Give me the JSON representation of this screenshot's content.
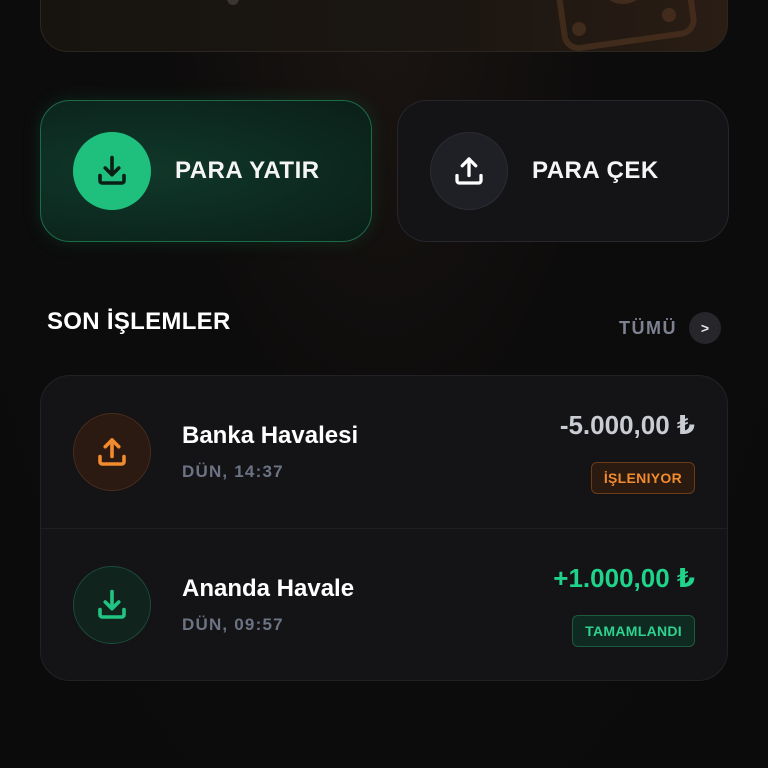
{
  "colors": {
    "accent_green": "#1fbf7e",
    "accent_orange": "#f28a2e",
    "positive_amount": "#1fd38a",
    "negative_amount": "#c9ccd3",
    "background": "#0b0b0c",
    "card": "#141417"
  },
  "actions": {
    "deposit": {
      "label": "PARA YATIR",
      "icon": "download-icon"
    },
    "withdraw": {
      "label": "PARA ÇEK",
      "icon": "upload-icon"
    }
  },
  "transactions_section": {
    "title": "SON İŞLEMLER",
    "see_all_label": "TÜMÜ",
    "see_all_icon_glyph": ">"
  },
  "transactions": [
    {
      "title": "Banka Havalesi",
      "time": "DÜN, 14:37",
      "amount": "-5.000,00 ₺",
      "status": "İŞLENIYOR",
      "direction": "out",
      "icon": "upload-icon"
    },
    {
      "title": "Ananda Havale",
      "time": "DÜN, 09:57",
      "amount": "+1.000,00 ₺",
      "status": "TAMAMLANDI",
      "direction": "in",
      "icon": "download-icon"
    }
  ]
}
